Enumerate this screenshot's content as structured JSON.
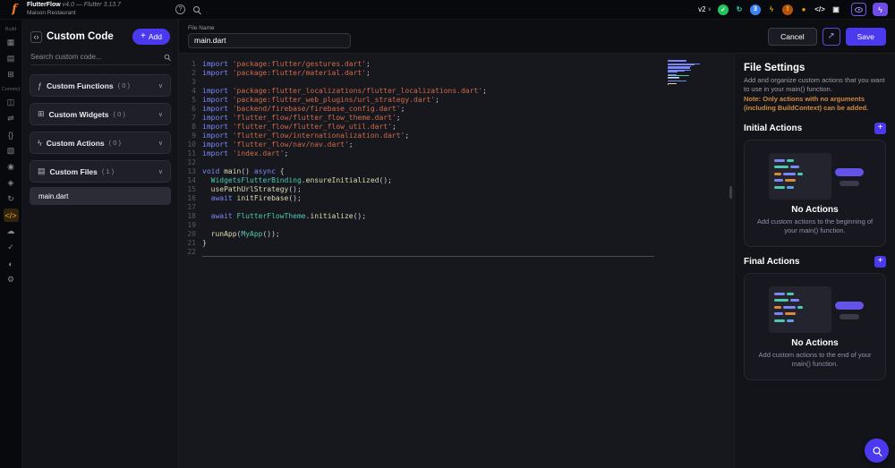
{
  "colors": {
    "accent": "#4b39ef",
    "active_icon": "#f5a623",
    "note": "#cf8a3e",
    "syntax": {
      "kw": "#7b87f7",
      "str": "#cd6a4a",
      "ty": "#4ec9b0",
      "fn": "#dcdcaf",
      "pl": "#cdced6"
    }
  },
  "topbar": {
    "logo": "f",
    "app_name": "FlutterFlow",
    "version": "v4.0 — Flutter 3.13.7",
    "project_name": "Maison Restaurant",
    "help_icon": "?",
    "version_dropdown": "v2",
    "status_icons": [
      {
        "name": "success-check-icon",
        "glyph": "✓",
        "bg": "#22c55e",
        "fg": "#ffffff"
      },
      {
        "name": "sync-history-icon",
        "glyph": "↻",
        "bg": "",
        "fg": "#2dd4bf"
      },
      {
        "name": "notification-count-badge",
        "glyph": "3",
        "bg": "#3b82f6",
        "fg": "#ffffff"
      },
      {
        "name": "upgrade-lightning-icon",
        "glyph": "ϟ",
        "bg": "",
        "fg": "#eab308"
      },
      {
        "name": "warning-icon",
        "glyph": "!",
        "bg": "#b45309",
        "fg": "#fde68a"
      },
      {
        "name": "account-icon",
        "glyph": "●",
        "bg": "",
        "fg": "#f59e0b"
      },
      {
        "name": "developer-code-icon",
        "glyph": "</>",
        "bg": "",
        "fg": "#e5e7eb"
      },
      {
        "name": "terminal-icon",
        "glyph": "▣",
        "bg": "",
        "fg": "#e5e7eb"
      }
    ]
  },
  "rail": {
    "items": [
      {
        "type": "label",
        "text": "Build"
      },
      {
        "type": "icon",
        "name": "storyboard-icon",
        "glyph": "▦"
      },
      {
        "type": "icon",
        "name": "pages-icon",
        "glyph": "▤"
      },
      {
        "type": "icon",
        "name": "components-icon",
        "glyph": "⊞"
      },
      {
        "type": "label",
        "text": "Connect"
      },
      {
        "type": "icon",
        "name": "database-icon",
        "glyph": "◫"
      },
      {
        "type": "icon",
        "name": "api-calls-icon",
        "glyph": "⇌"
      },
      {
        "type": "icon",
        "name": "data-types-icon",
        "glyph": "{}"
      },
      {
        "type": "icon",
        "name": "media-assets-icon",
        "glyph": "▧"
      },
      {
        "type": "icon",
        "name": "auth-icon",
        "glyph": "◉"
      },
      {
        "type": "icon",
        "name": "app-state-icon",
        "glyph": "◈"
      },
      {
        "type": "icon",
        "name": "automations-icon",
        "glyph": "↻"
      },
      {
        "type": "icon",
        "name": "custom-code-icon",
        "glyph": "</>",
        "active": true
      },
      {
        "type": "icon",
        "name": "cloud-functions-icon",
        "glyph": "☁"
      },
      {
        "type": "icon",
        "name": "tests-icon",
        "glyph": "✓"
      },
      {
        "type": "icon",
        "name": "theme-icon",
        "glyph": "◐"
      },
      {
        "type": "icon",
        "name": "settings-gear-icon",
        "glyph": "⚙"
      }
    ]
  },
  "panel": {
    "title": "Custom Code",
    "add_icon": "+",
    "add_label": "Add",
    "search_placeholder": "Search custom code...",
    "chevron": "∨",
    "sections": [
      {
        "icon": "ƒ",
        "label": "Custom Functions",
        "count": "( 0 )"
      },
      {
        "icon": "⊞",
        "label": "Custom Widgets",
        "count": "( 0 )"
      },
      {
        "icon": "ϟ",
        "label": "Custom Actions",
        "count": "( 0 )"
      },
      {
        "icon": "▤",
        "label": "Custom Files",
        "count": "( 1 )"
      }
    ],
    "selected_file": "main.dart"
  },
  "editor": {
    "file_name_label": "File Name",
    "file_name_value": "main.dart",
    "cancel_button": "Cancel",
    "open_icon": "↗",
    "save_button": "Save"
  },
  "code": {
    "cursor_line": 22,
    "lines": [
      [
        [
          "kw",
          "import "
        ],
        [
          "str",
          "'package:flutter/gestures.dart'"
        ],
        [
          "pl",
          ";"
        ]
      ],
      [
        [
          "kw",
          "import "
        ],
        [
          "str",
          "'package:flutter/material.dart'"
        ],
        [
          "pl",
          ";"
        ]
      ],
      [],
      [
        [
          "kw",
          "import "
        ],
        [
          "str",
          "'package:flutter_localizations/flutter_localizations.dart'"
        ],
        [
          "pl",
          ";"
        ]
      ],
      [
        [
          "kw",
          "import "
        ],
        [
          "str",
          "'package:flutter_web_plugins/url_strategy.dart'"
        ],
        [
          "pl",
          ";"
        ]
      ],
      [
        [
          "kw",
          "import "
        ],
        [
          "str",
          "'backend/firebase/firebase_config.dart'"
        ],
        [
          "pl",
          ";"
        ]
      ],
      [
        [
          "kw",
          "import "
        ],
        [
          "str",
          "'flutter_flow/flutter_flow_theme.dart'"
        ],
        [
          "pl",
          ";"
        ]
      ],
      [
        [
          "kw",
          "import "
        ],
        [
          "str",
          "'flutter_flow/flutter_flow_util.dart'"
        ],
        [
          "pl",
          ";"
        ]
      ],
      [
        [
          "kw",
          "import "
        ],
        [
          "str",
          "'flutter_flow/internationalization.dart'"
        ],
        [
          "pl",
          ";"
        ]
      ],
      [
        [
          "kw",
          "import "
        ],
        [
          "str",
          "'flutter_flow/nav/nav.dart'"
        ],
        [
          "pl",
          ";"
        ]
      ],
      [
        [
          "kw",
          "import "
        ],
        [
          "str",
          "'index.dart'"
        ],
        [
          "pl",
          ";"
        ]
      ],
      [],
      [
        [
          "kw",
          "void "
        ],
        [
          "fn",
          "main"
        ],
        [
          "pl",
          "() "
        ],
        [
          "kw",
          "async "
        ],
        [
          "pl",
          "{"
        ]
      ],
      [
        [
          "pl",
          "  "
        ],
        [
          "ty",
          "WidgetsFlutterBinding"
        ],
        [
          "pl",
          "."
        ],
        [
          "fn",
          "ensureInitialized"
        ],
        [
          "pl",
          "();"
        ]
      ],
      [
        [
          "pl",
          "  "
        ],
        [
          "fn",
          "usePathUrlStrategy"
        ],
        [
          "pl",
          "();"
        ]
      ],
      [
        [
          "pl",
          "  "
        ],
        [
          "kw",
          "await "
        ],
        [
          "fn",
          "initFirebase"
        ],
        [
          "pl",
          "();"
        ]
      ],
      [],
      [
        [
          "pl",
          "  "
        ],
        [
          "kw",
          "await "
        ],
        [
          "ty",
          "FlutterFlowTheme"
        ],
        [
          "pl",
          "."
        ],
        [
          "fn",
          "initialize"
        ],
        [
          "pl",
          "();"
        ]
      ],
      [],
      [
        [
          "pl",
          "  "
        ],
        [
          "fn",
          "runApp"
        ],
        [
          "pl",
          "("
        ],
        [
          "ty",
          "MyApp"
        ],
        [
          "pl",
          "());"
        ]
      ],
      [
        [
          "pl",
          "}"
        ]
      ],
      []
    ]
  },
  "settings": {
    "title": "File Settings",
    "description": "Add and organize custom actions that you want to use in your main() function.",
    "note": "Note: Only actions with no arguments (including BuildContext) can be added.",
    "plus_icon": "+",
    "sections": [
      {
        "title": "Initial Actions",
        "empty_title": "No Actions",
        "empty_text": "Add custom actions to the beginning of your main() function."
      },
      {
        "title": "Final Actions",
        "empty_title": "No Actions",
        "empty_text": "Add custom actions to the end of your main() function."
      }
    ]
  }
}
